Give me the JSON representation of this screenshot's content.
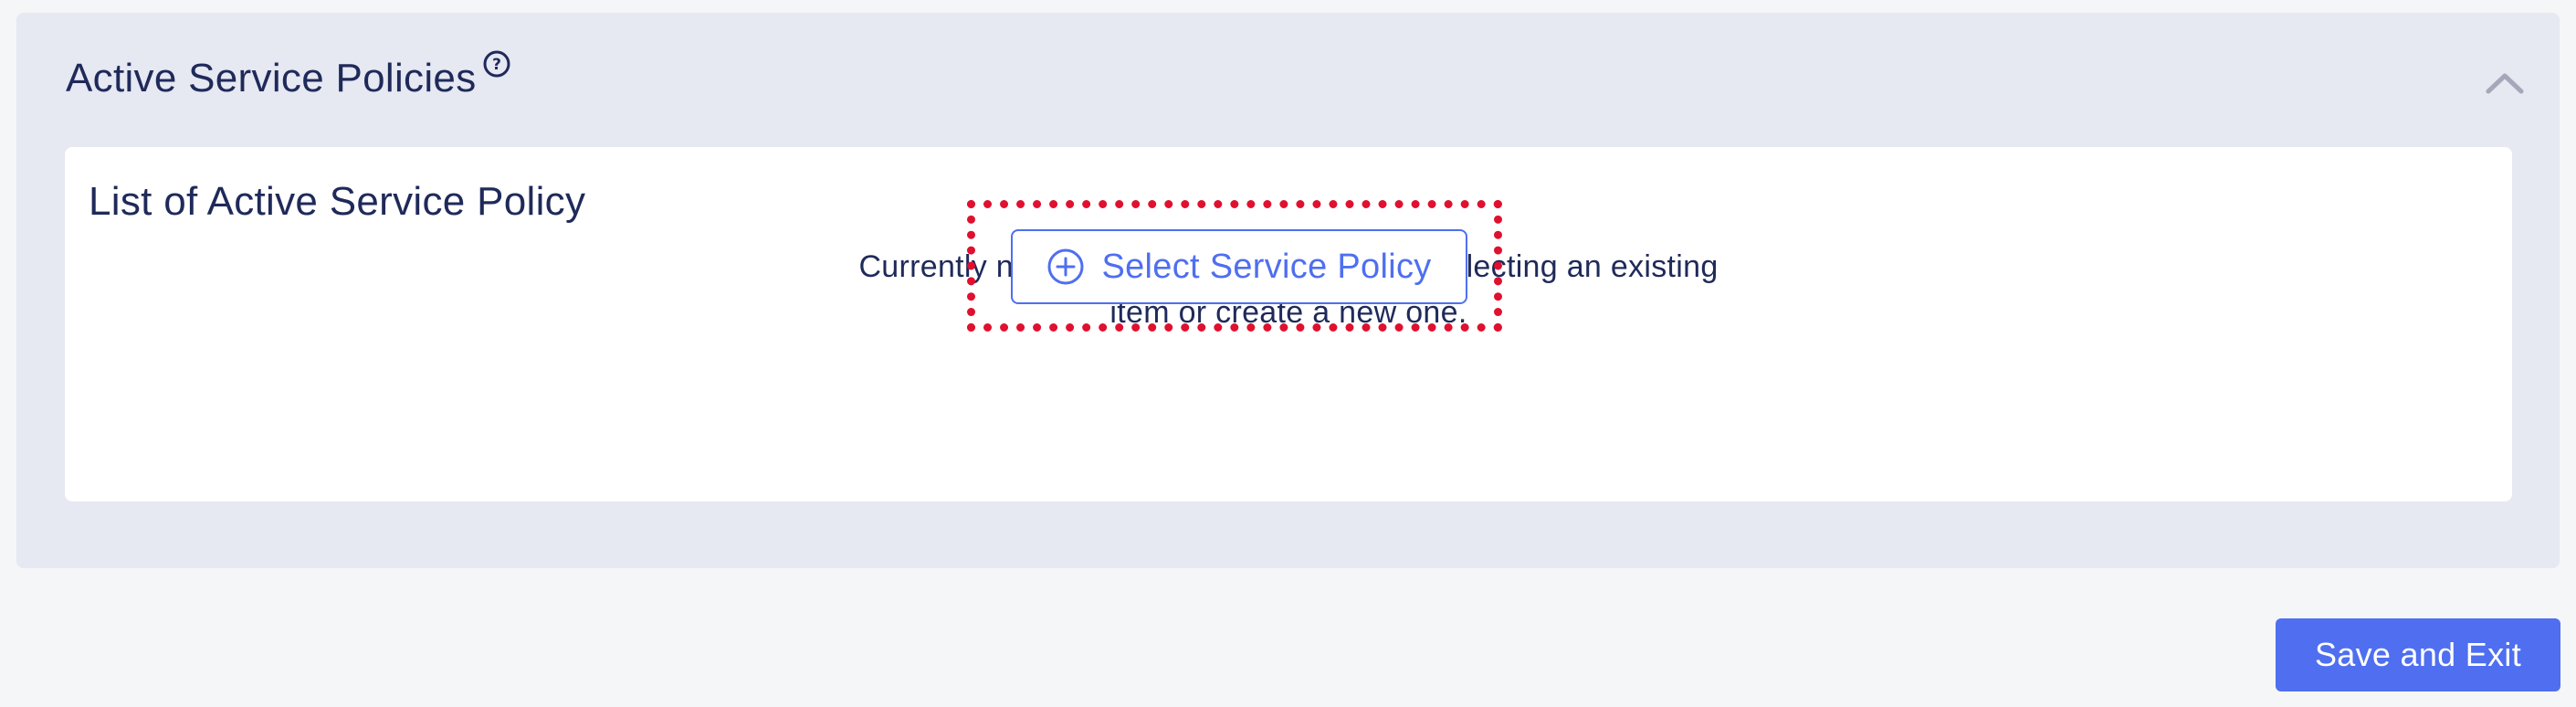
{
  "section": {
    "title": "Active Service Policies",
    "help_icon": "help-circle-icon",
    "collapse_icon": "chevron-up-icon"
  },
  "card": {
    "title": "List of Active Service Policy",
    "empty_message": "Currently no items are selected. Start by selecting an existing item or create a new one.",
    "select_button_label": "Select Service Policy",
    "select_button_icon": "plus-circle-icon"
  },
  "footer": {
    "save_exit_label": "Save and Exit"
  },
  "colors": {
    "accent": "#4f6ff0",
    "section_bg": "#e6e8f2",
    "highlight": "#e0102f",
    "text": "#1f2a5a"
  }
}
